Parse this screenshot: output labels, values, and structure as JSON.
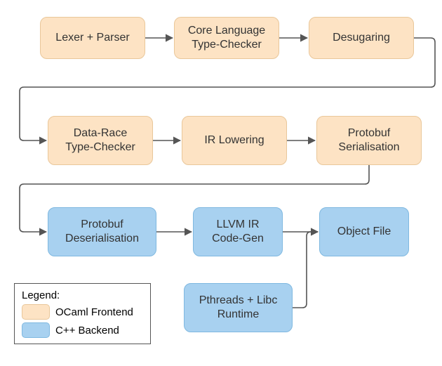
{
  "nodes": {
    "lexer": {
      "label": "Lexer + Parser"
    },
    "core_checker": {
      "label": "Core Language\nType-Checker"
    },
    "desugaring": {
      "label": "Desugaring"
    },
    "datarace": {
      "label": "Data-Race\nType-Checker"
    },
    "irlower": {
      "label": "IR Lowering"
    },
    "pb_ser": {
      "label": "Protobuf\nSerialisation"
    },
    "pb_deser": {
      "label": "Protobuf\nDeserialisation"
    },
    "llvm": {
      "label": "LLVM IR\nCode-Gen"
    },
    "objfile": {
      "label": "Object File"
    },
    "runtime": {
      "label": "Pthreads + Libc\nRuntime"
    }
  },
  "legend": {
    "title": "Legend:",
    "ocaml": "OCaml Frontend",
    "cpp": "C++ Backend"
  },
  "colors": {
    "ocaml_fill": "#fde3c4",
    "cpp_fill": "#a8d1f0"
  },
  "chart_data": {
    "type": "diagram",
    "title": "",
    "groups": [
      {
        "name": "OCaml Frontend",
        "color": "#fde3c4",
        "nodes": [
          "Lexer + Parser",
          "Core Language Type-Checker",
          "Desugaring",
          "Data-Race Type-Checker",
          "IR Lowering",
          "Protobuf Serialisation"
        ]
      },
      {
        "name": "C++ Backend",
        "color": "#a8d1f0",
        "nodes": [
          "Protobuf Deserialisation",
          "LLVM IR Code-Gen",
          "Object File",
          "Pthreads + Libc Runtime"
        ]
      }
    ],
    "edges": [
      [
        "Lexer + Parser",
        "Core Language Type-Checker"
      ],
      [
        "Core Language Type-Checker",
        "Desugaring"
      ],
      [
        "Desugaring",
        "Data-Race Type-Checker"
      ],
      [
        "Data-Race Type-Checker",
        "IR Lowering"
      ],
      [
        "IR Lowering",
        "Protobuf Serialisation"
      ],
      [
        "Protobuf Serialisation",
        "Protobuf Deserialisation"
      ],
      [
        "Protobuf Deserialisation",
        "LLVM IR Code-Gen"
      ],
      [
        "LLVM IR Code-Gen",
        "Object File"
      ],
      [
        "Pthreads + Libc Runtime",
        "Object File"
      ]
    ]
  }
}
